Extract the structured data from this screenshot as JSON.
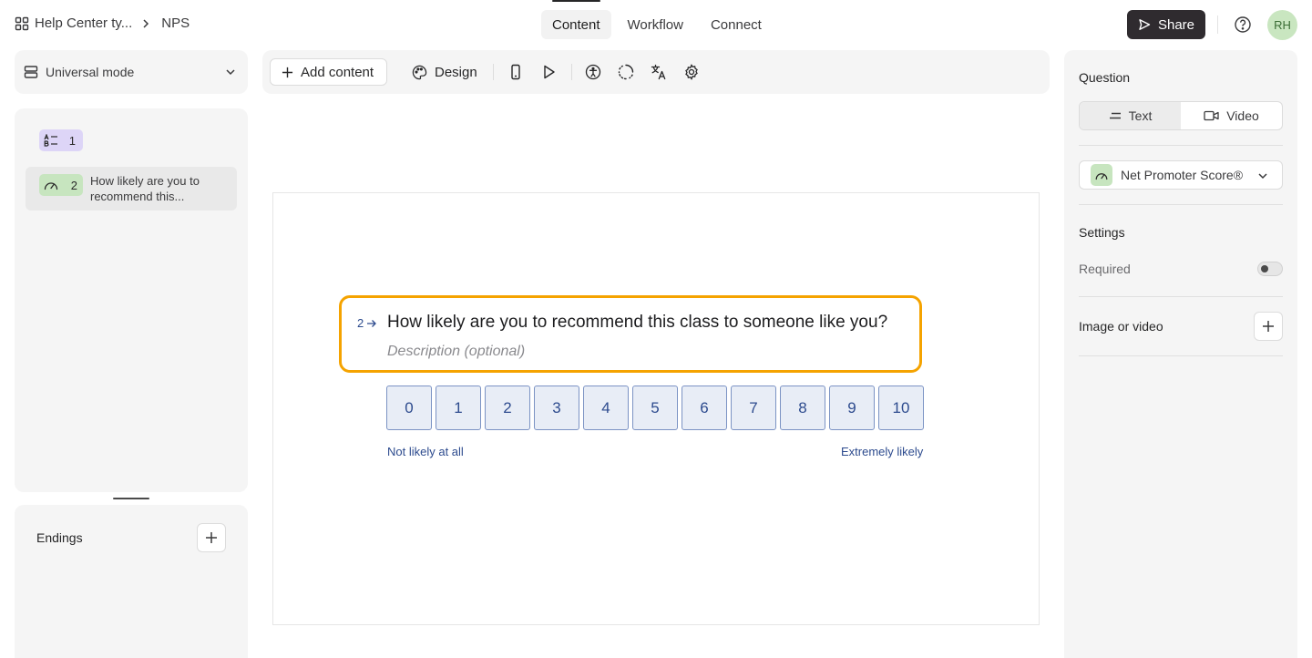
{
  "breadcrumb": {
    "workspace": "Help Center ty...",
    "form": "NPS"
  },
  "nav_tabs": [
    {
      "label": "Content",
      "active": true
    },
    {
      "label": "Workflow",
      "active": false
    },
    {
      "label": "Connect",
      "active": false
    }
  ],
  "header": {
    "share_label": "Share",
    "avatar_initials": "RH"
  },
  "mode": {
    "label": "Universal mode"
  },
  "questions": [
    {
      "number": "1",
      "type_icon": "short-text-icon",
      "label": ""
    },
    {
      "number": "2",
      "type_icon": "gauge-icon",
      "label": "How likely are you to recommend this..."
    }
  ],
  "endings": {
    "title": "Endings"
  },
  "toolbar": {
    "add_content_label": "Add content",
    "design_label": "Design",
    "icons": [
      "mobile-preview-icon",
      "play-icon",
      "accessibility-icon",
      "loading-icon",
      "translate-icon",
      "settings-icon"
    ]
  },
  "canvas_question": {
    "number": "2",
    "title": "How likely are you to recommend this class to someone like you?",
    "description_placeholder": "Description (optional)",
    "scale": [
      "0",
      "1",
      "2",
      "3",
      "4",
      "5",
      "6",
      "7",
      "8",
      "9",
      "10"
    ],
    "label_left": "Not likely at all",
    "label_right": "Extremely likely"
  },
  "right_panel": {
    "section_title": "Question",
    "media_options": [
      {
        "label": "Text",
        "active": true
      },
      {
        "label": "Video",
        "active": false
      }
    ],
    "question_type": "Net Promoter Score®",
    "settings_title": "Settings",
    "required_label": "Required",
    "required_on": false,
    "image_video_label": "Image or video"
  },
  "colors": {
    "highlight": "#f5a300",
    "answer_blue": "#2d4b8e",
    "answer_bg": "#e8edf6",
    "nps_badge": "#c7e5bf",
    "text_badge": "#ddd5f7"
  }
}
